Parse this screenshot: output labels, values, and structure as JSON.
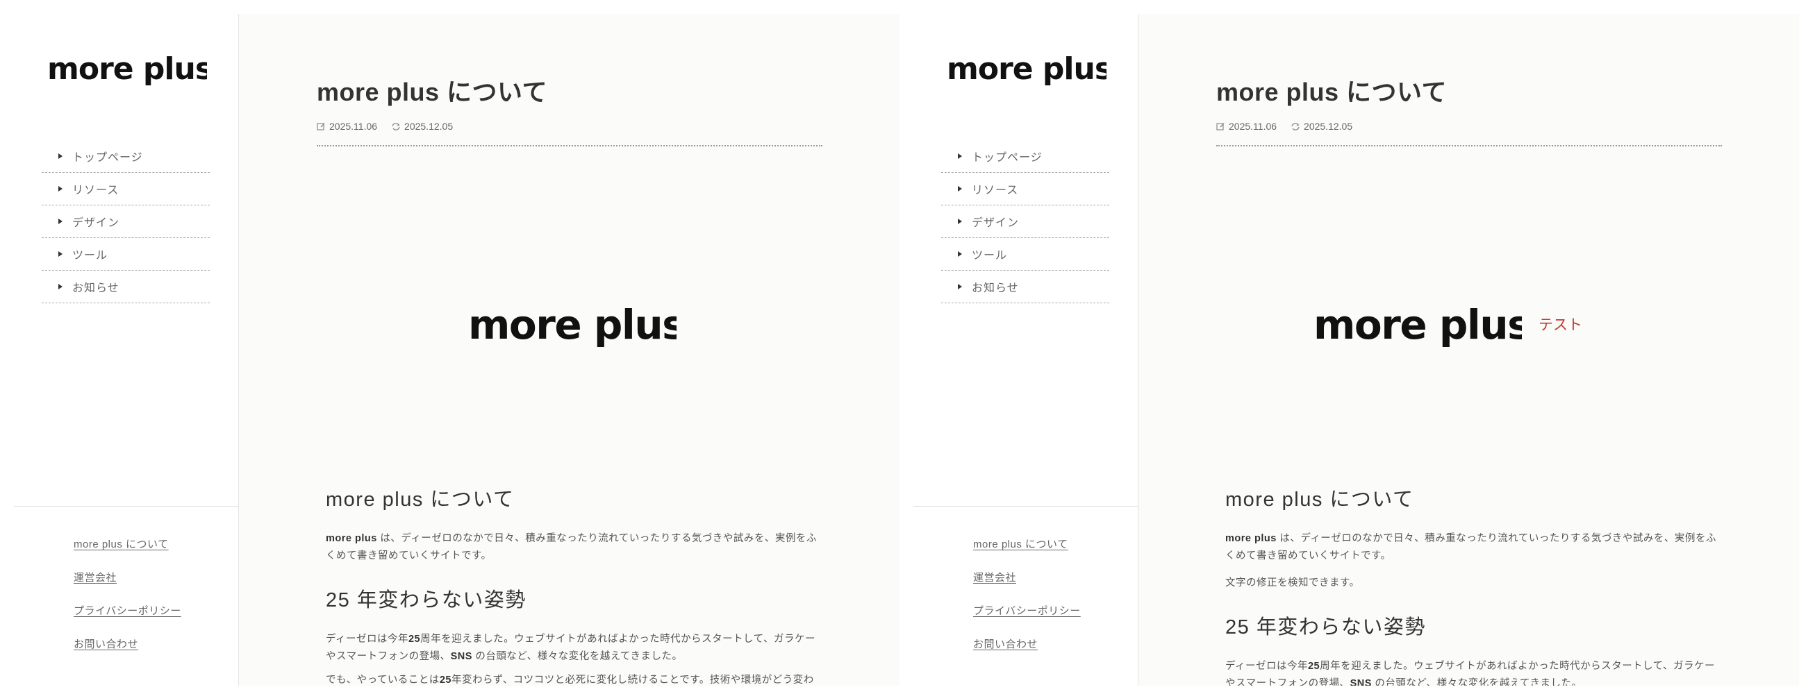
{
  "site": {
    "logo_text": "more plus"
  },
  "nav": {
    "items": [
      {
        "label": "トップページ"
      },
      {
        "label": "リソース"
      },
      {
        "label": "デザイン"
      },
      {
        "label": "ツール"
      },
      {
        "label": "お知らせ"
      }
    ]
  },
  "footer": {
    "links": [
      {
        "label": "more plus について"
      },
      {
        "label": "運営会社"
      },
      {
        "label": "プライバシーポリシー"
      },
      {
        "label": "お問い合わせ"
      }
    ]
  },
  "article": {
    "title": "more plus について",
    "published": "2025.11.06",
    "updated": "2025.12.05",
    "hero_test_label": "テスト",
    "section1_heading_brand": "more plus",
    "section1_heading_rest": " について",
    "intro_brand": "more plus",
    "intro_rest": " は、ディーゼロのなかで日々、積み重なったり流れていったりする気づきや試みを、実例をふくめて書き留めていくサイトです。",
    "correction_note": "文字の修正を検知できます。",
    "section2_heading_num": "25",
    "section2_heading_rest": " 年変わらない姿勢",
    "para2_a": "ディーゼロは今年",
    "para2_num": "25",
    "para2_b": "周年を迎えました。ウェブサイトがあればよかった時代からスタートして、ガラケーやスマートフォンの登場、",
    "para2_sns": "SNS",
    "para2_c": " の台頭など、様々な変化を越えてきました。",
    "para3_a": "でも、やっていることは",
    "para3_num": "25",
    "para3_b": "年変わらず、コツコツと必死に変化し続けることです。技術や環境がどう変わっても、この姿勢だけは一貫しています。"
  }
}
